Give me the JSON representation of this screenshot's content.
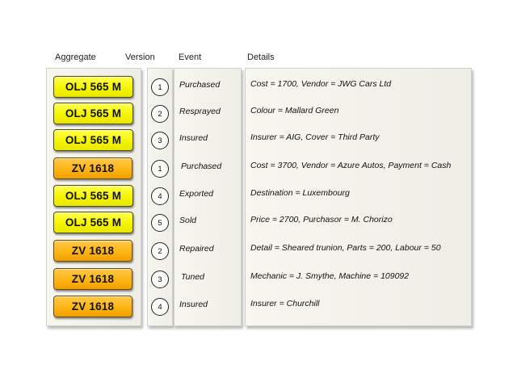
{
  "headers": {
    "aggregate": "Aggregate",
    "version": "Version",
    "event": "Event",
    "details": "Details"
  },
  "rows": [
    {
      "plate": "OLJ 565 M",
      "color": "yellow",
      "version": "1",
      "event": "Purchased",
      "details": "Cost = 1700, Vendor = JWG Cars Ltd"
    },
    {
      "plate": "OLJ 565 M",
      "color": "yellow",
      "version": "2",
      "event": "Resprayed",
      "details": "Colour = Mallard Green"
    },
    {
      "plate": "OLJ 565 M",
      "color": "yellow",
      "version": "3",
      "event": "Insured",
      "details": "Insurer = AIG, Cover = Third Party"
    },
    {
      "plate": "ZV 1618",
      "color": "orange",
      "version": "1",
      "event": "Purchased",
      "details": "Cost = 3700, Vendor = Azure Autos, Payment = Cash"
    },
    {
      "plate": "OLJ 565 M",
      "color": "yellow",
      "version": "4",
      "event": "Exported",
      "details": "Destination = Luxembourg"
    },
    {
      "plate": "OLJ 565 M",
      "color": "yellow",
      "version": "5",
      "event": "Sold",
      "details": "Price = 2700, Purchasor = M. Chorizo"
    },
    {
      "plate": "ZV 1618",
      "color": "orange",
      "version": "2",
      "event": "Repaired",
      "details": "Detail = Sheared trunion, Parts = 200, Labour = 50"
    },
    {
      "plate": "ZV 1618",
      "color": "orange",
      "version": "3",
      "event": "Tuned",
      "details": "Mechanic = J. Smythe, Machine = 109092"
    },
    {
      "plate": "ZV 1618",
      "color": "orange",
      "version": "4",
      "event": "Insured",
      "details": "Insurer = Churchill"
    }
  ]
}
